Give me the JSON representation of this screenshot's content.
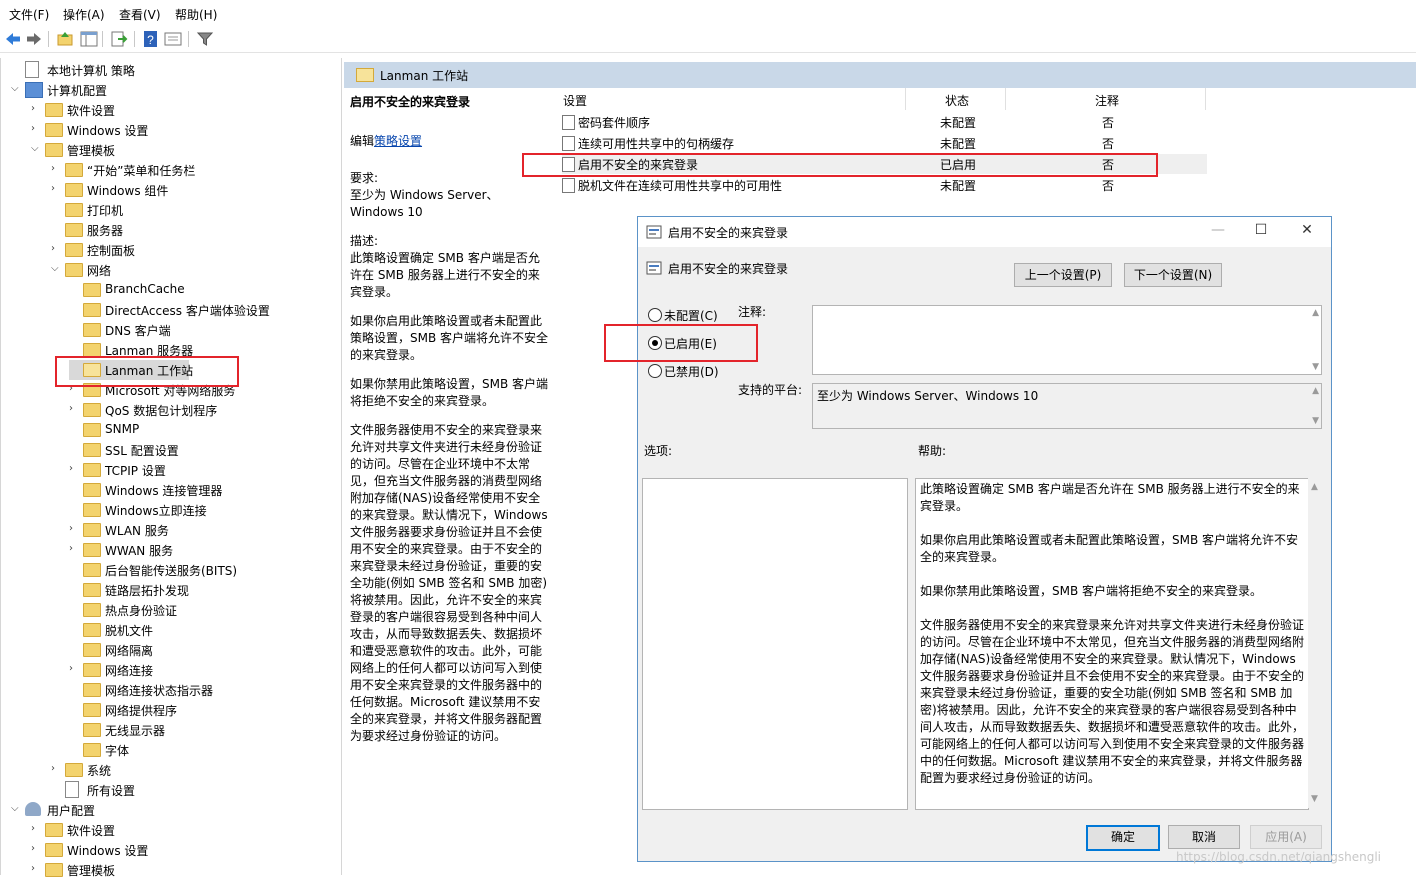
{
  "menu": [
    "文件(F)",
    "操作(A)",
    "查看(V)",
    "帮助(H)"
  ],
  "toolbar_icons": [
    "back-arrow-icon",
    "forward-arrow-icon",
    "up-folder-icon",
    "show-hide-tree-icon",
    "export-list-icon",
    "help-icon",
    "properties-icon",
    "filter-icon"
  ],
  "tree": [
    {
      "label": "本地计算机 策略",
      "level": 0,
      "icon": "doc",
      "arrow": ""
    },
    {
      "label": "计算机配置",
      "level": 0,
      "icon": "pc",
      "arrow": "v"
    },
    {
      "label": "软件设置",
      "level": 1,
      "icon": "folder",
      "arrow": ">"
    },
    {
      "label": "Windows 设置",
      "level": 1,
      "icon": "folder",
      "arrow": ">"
    },
    {
      "label": "管理模板",
      "level": 1,
      "icon": "folder",
      "arrow": "v"
    },
    {
      "label": "“开始”菜单和任务栏",
      "level": 2,
      "icon": "folder",
      "arrow": ">"
    },
    {
      "label": "Windows 组件",
      "level": 2,
      "icon": "folder",
      "arrow": ">"
    },
    {
      "label": "打印机",
      "level": 2,
      "icon": "folder",
      "arrow": ""
    },
    {
      "label": "服务器",
      "level": 2,
      "icon": "folder",
      "arrow": ""
    },
    {
      "label": "控制面板",
      "level": 2,
      "icon": "folder",
      "arrow": ">"
    },
    {
      "label": "网络",
      "level": 2,
      "icon": "folder",
      "arrow": "v"
    },
    {
      "label": "BranchCache",
      "level": 3,
      "icon": "folder",
      "arrow": ""
    },
    {
      "label": "DirectAccess 客户端体验设置",
      "level": 3,
      "icon": "folder",
      "arrow": ""
    },
    {
      "label": "DNS 客户端",
      "level": 3,
      "icon": "folder",
      "arrow": ""
    },
    {
      "label": "Lanman 服务器",
      "level": 3,
      "icon": "folder",
      "arrow": ""
    },
    {
      "label": "Lanman 工作站",
      "level": 3,
      "icon": "folder-open",
      "arrow": "",
      "selected": true
    },
    {
      "label": "Microsoft 对等网络服务",
      "level": 3,
      "icon": "folder",
      "arrow": ">"
    },
    {
      "label": "QoS 数据包计划程序",
      "level": 3,
      "icon": "folder",
      "arrow": ">"
    },
    {
      "label": "SNMP",
      "level": 3,
      "icon": "folder",
      "arrow": ""
    },
    {
      "label": "SSL 配置设置",
      "level": 3,
      "icon": "folder",
      "arrow": ""
    },
    {
      "label": "TCPIP 设置",
      "level": 3,
      "icon": "folder",
      "arrow": ">"
    },
    {
      "label": "Windows 连接管理器",
      "level": 3,
      "icon": "folder",
      "arrow": ""
    },
    {
      "label": "Windows立即连接",
      "level": 3,
      "icon": "folder",
      "arrow": ""
    },
    {
      "label": "WLAN 服务",
      "level": 3,
      "icon": "folder",
      "arrow": ">"
    },
    {
      "label": "WWAN 服务",
      "level": 3,
      "icon": "folder",
      "arrow": ">"
    },
    {
      "label": "后台智能传送服务(BITS)",
      "level": 3,
      "icon": "folder",
      "arrow": ""
    },
    {
      "label": "链路层拓扑发现",
      "level": 3,
      "icon": "folder",
      "arrow": ""
    },
    {
      "label": "热点身份验证",
      "level": 3,
      "icon": "folder",
      "arrow": ""
    },
    {
      "label": "脱机文件",
      "level": 3,
      "icon": "folder",
      "arrow": ""
    },
    {
      "label": "网络隔离",
      "level": 3,
      "icon": "folder",
      "arrow": ""
    },
    {
      "label": "网络连接",
      "level": 3,
      "icon": "folder",
      "arrow": ">"
    },
    {
      "label": "网络连接状态指示器",
      "level": 3,
      "icon": "folder",
      "arrow": ""
    },
    {
      "label": "网络提供程序",
      "level": 3,
      "icon": "folder",
      "arrow": ""
    },
    {
      "label": "无线显示器",
      "level": 3,
      "icon": "folder",
      "arrow": ""
    },
    {
      "label": "字体",
      "level": 3,
      "icon": "folder",
      "arrow": ""
    },
    {
      "label": "系统",
      "level": 2,
      "icon": "folder",
      "arrow": ">"
    },
    {
      "label": "所有设置",
      "level": 2,
      "icon": "doc",
      "arrow": ""
    },
    {
      "label": "用户配置",
      "level": 0,
      "icon": "user",
      "arrow": "v"
    },
    {
      "label": "软件设置",
      "level": 1,
      "icon": "folder",
      "arrow": ">"
    },
    {
      "label": "Windows 设置",
      "level": 1,
      "icon": "folder",
      "arrow": ">"
    },
    {
      "label": "管理模板",
      "level": 1,
      "icon": "folder",
      "arrow": ">"
    }
  ],
  "right": {
    "header": "Lanman 工作站",
    "desc_title": "启用不安全的来宾登录",
    "edit_prefix": "编辑",
    "edit_link": "策略设置",
    "req_label": "要求:",
    "req_text": "至少为 Windows Server、Windows 10",
    "desc_label": "描述:",
    "desc_p1": "此策略设置确定 SMB 客户端是否允许在 SMB 服务器上进行不安全的来宾登录。",
    "desc_p2": "如果你启用此策略设置或者未配置此策略设置，SMB 客户端将允许不安全的来宾登录。",
    "desc_p3": "如果你禁用此策略设置，SMB 客户端将拒绝不安全的来宾登录。",
    "desc_p4": "文件服务器使用不安全的来宾登录来允许对共享文件夹进行未经身份验证的访问。尽管在企业环境中不太常见，但充当文件服务器的消费型网络附加存储(NAS)设备经常使用不安全的来宾登录。默认情况下，Windows 文件服务器要求身份验证并且不会使用不安全的来宾登录。由于不安全的来宾登录未经过身份验证，重要的安全功能(例如 SMB 签名和 SMB 加密)将被禁用。因此，允许不安全的来宾登录的客户端很容易受到各种中间人攻击，从而导致数据丢失、数据损坏和遭受恶意软件的攻击。此外，可能网络上的任何人都可以访问写入到使用不安全来宾登录的文件服务器中的任何数据。Microsoft 建议禁用不安全的来宾登录，并将文件服务器配置为要求经过身份验证的访问。",
    "columns": [
      "设置",
      "状态",
      "注释"
    ],
    "rows": [
      {
        "name": "密码套件顺序",
        "state": "未配置",
        "comment": "否"
      },
      {
        "name": "连续可用性共享中的句柄缓存",
        "state": "未配置",
        "comment": "否"
      },
      {
        "name": "启用不安全的来宾登录",
        "state": "已启用",
        "comment": "否",
        "selected": true
      },
      {
        "name": "脱机文件在连续可用性共享中的可用性",
        "state": "未配置",
        "comment": "否"
      }
    ]
  },
  "dialog": {
    "title": "启用不安全的来宾登录",
    "setting_name": "启用不安全的来宾登录",
    "prev_btn": "上一个设置(P)",
    "next_btn": "下一个设置(N)",
    "radio_not_configured": "未配置(C)",
    "radio_enabled": "已启用(E)",
    "radio_disabled": "已禁用(D)",
    "selected_option": "已启用(E)",
    "comment_label": "注释:",
    "comment_value": "",
    "platform_label": "支持的平台:",
    "platform_value": "至少为 Windows Server、Windows 10",
    "options_label": "选项:",
    "help_label": "帮助:",
    "help_p1": "此策略设置确定 SMB 客户端是否允许在 SMB 服务器上进行不安全的来宾登录。",
    "help_p2": "如果你启用此策略设置或者未配置此策略设置，SMB 客户端将允许不安全的来宾登录。",
    "help_p3": "如果你禁用此策略设置，SMB 客户端将拒绝不安全的来宾登录。",
    "help_p4": "文件服务器使用不安全的来宾登录来允许对共享文件夹进行未经身份验证的访问。尽管在企业环境中不太常见，但充当文件服务器的消费型网络附加存储(NAS)设备经常使用不安全的来宾登录。默认情况下，Windows 文件服务器要求身份验证并且不会使用不安全的来宾登录。由于不安全的来宾登录未经过身份验证，重要的安全功能(例如 SMB 签名和 SMB 加密)将被禁用。因此，允许不安全的来宾登录的客户端很容易受到各种中间人攻击，从而导致数据丢失、数据损坏和遭受恶意软件的攻击。此外，可能网络上的任何人都可以访问写入到使用不安全来宾登录的文件服务器中的任何数据。Microsoft 建议禁用不安全的来宾登录，并将文件服务器配置为要求经过身份验证的访问。",
    "ok_btn": "确定",
    "cancel_btn": "取消",
    "apply_btn": "应用(A)"
  },
  "watermark": "https://blog.csdn.net/qiangshengli",
  "colors": {
    "highlight_red": "#e3242b",
    "dialog_border": "#5b93c8",
    "header_bg": "#c9d8e8"
  }
}
